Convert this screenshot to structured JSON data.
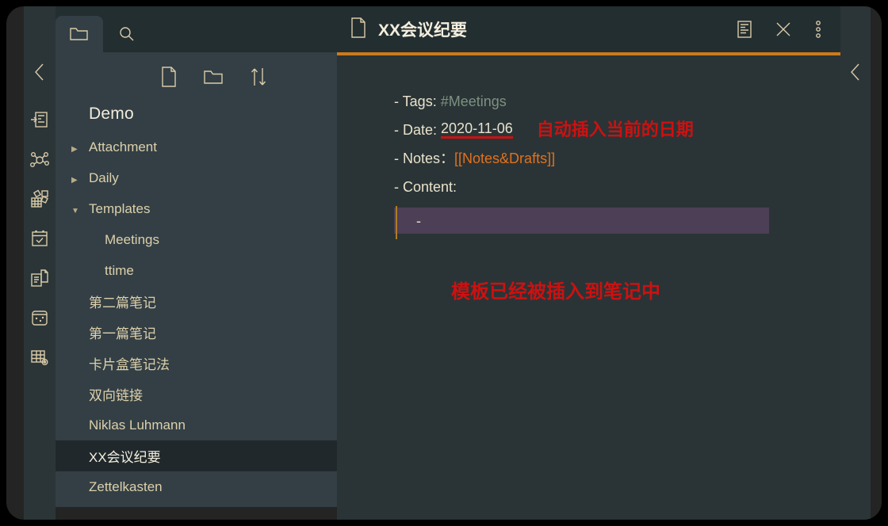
{
  "window": {
    "title": "XX会议纪要"
  },
  "left_rail": {
    "collapse_icon": "chevron-left-icon",
    "items": [
      {
        "name": "outline-insert-icon",
        "label": "Outline"
      },
      {
        "name": "graph-view-icon",
        "label": "Graph view"
      },
      {
        "name": "blocks-grid-icon",
        "label": "Blocks"
      },
      {
        "name": "calendar-check-icon",
        "label": "Calendar"
      },
      {
        "name": "copy-documents-icon",
        "label": "Documents"
      },
      {
        "name": "card-box-icon",
        "label": "Card box"
      },
      {
        "name": "table-settings-icon",
        "label": "Table settings"
      }
    ]
  },
  "right_rail": {
    "collapse_icon": "chevron-left-icon"
  },
  "file_panel": {
    "tabs": [
      {
        "name": "folder-tab",
        "icon": "folder-icon",
        "active": true
      },
      {
        "name": "search-tab",
        "icon": "search-icon",
        "active": false
      }
    ],
    "toolbar": [
      {
        "name": "new-note-button",
        "icon": "new-file-icon"
      },
      {
        "name": "new-folder-button",
        "icon": "new-folder-icon"
      },
      {
        "name": "sort-button",
        "icon": "sort-arrows-icon"
      }
    ],
    "vault_name": "Demo",
    "tree": [
      {
        "label": "Attachment",
        "type": "folder",
        "expanded": false,
        "depth": 0,
        "selected": false
      },
      {
        "label": "Daily",
        "type": "folder",
        "expanded": false,
        "depth": 0,
        "selected": false
      },
      {
        "label": "Templates",
        "type": "folder",
        "expanded": true,
        "depth": 0,
        "selected": false
      },
      {
        "label": "Meetings",
        "type": "file",
        "depth": 1,
        "selected": false
      },
      {
        "label": "ttime",
        "type": "file",
        "depth": 1,
        "selected": false
      },
      {
        "label": "第二篇笔记",
        "type": "file",
        "depth": 0,
        "selected": false
      },
      {
        "label": "第一篇笔记",
        "type": "file",
        "depth": 0,
        "selected": false
      },
      {
        "label": "卡片盒笔记法",
        "type": "file",
        "depth": 0,
        "selected": false
      },
      {
        "label": "双向链接",
        "type": "file",
        "depth": 0,
        "selected": false
      },
      {
        "label": "Niklas Luhmann",
        "type": "file",
        "depth": 0,
        "selected": false
      },
      {
        "label": "XX会议纪要",
        "type": "file",
        "depth": 0,
        "selected": true
      },
      {
        "label": "Zettelkasten",
        "type": "file",
        "depth": 0,
        "selected": false
      }
    ]
  },
  "editor": {
    "doc_icon": "file-icon",
    "title": "XX会议纪要",
    "header_actions": [
      {
        "name": "outline-panel-icon",
        "label": "Outline"
      },
      {
        "name": "close-icon",
        "label": "Close"
      },
      {
        "name": "more-options-icon",
        "label": "More"
      }
    ],
    "lines": {
      "tags_prefix": "- Tags: ",
      "tags_value": "#Meetings",
      "date_prefix": "- Date: ",
      "date_value": "2020-11-06",
      "date_annotation": "自动插入当前的日期",
      "notes_prefix": "- Notes：",
      "notes_value": "[[Notes&Drafts]]",
      "content_prefix": "- Content:",
      "content_dash": "-"
    },
    "center_annotation": "模板已经被插入到笔记中"
  },
  "colors": {
    "accent_orange": "#cc7a1e",
    "annotation_red": "#cc1111",
    "tag_green": "#7d9180",
    "link_orange": "#e2711d",
    "highlight_purple": "#4d3f55",
    "editor_bg": "#2a3436",
    "panel_bg": "#333f45",
    "rail_bg": "#2b3538",
    "text_cream": "#e9e2cd"
  }
}
